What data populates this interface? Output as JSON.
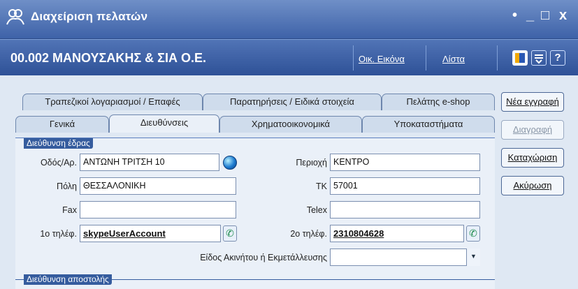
{
  "window": {
    "title": "Διαχείριση πελατών",
    "controls": [
      "•",
      "_",
      "□",
      "x"
    ]
  },
  "header": {
    "record_title": "00.002 ΜΑΝΟΥΣΑΚΗΣ & ΣΙΑ Ο.Ε.",
    "links": [
      "Οικ. Εικόνα",
      "Λίστα"
    ],
    "help": "?"
  },
  "tabs": {
    "row1": [
      "Τραπεζικοί λογαριασμοί / Επαφές",
      "Παρατηρήσεις / Ειδικά στοιχεία",
      "Πελάτης e-shop"
    ],
    "row2": [
      "Γενικά",
      "Διευθύνσεις",
      "Χρηματοοικονομικά",
      "Υποκαταστήματα"
    ],
    "active": "Διευθύνσεις"
  },
  "sections": {
    "seat": "Διεύθυνση έδρας",
    "shipping": "Διεύθυνση αποστολής"
  },
  "form": {
    "street_label": "Οδός/Αρ.",
    "street_value": "ΑΝΤΩΝΗ ΤΡΙΤΣΗ 10",
    "area_label": "Περιοχή",
    "area_value": "ΚΕΝΤΡΟ",
    "city_label": "Πόλη",
    "city_value": "ΘΕΣΣΑΛΟΝΙΚΗ",
    "zip_label": "ΤΚ",
    "zip_value": "57001",
    "fax_label": "Fax",
    "fax_value": "",
    "telex_label": "Telex",
    "telex_value": "",
    "phone1_label": "1ο τηλέφ.",
    "phone1_value": "skypeUserAccount",
    "phone2_label": "2ο τηλέφ.",
    "phone2_value": "2310804628",
    "property_label": "Είδος Ακινήτου ή Εκμετάλλευσης",
    "property_value": ""
  },
  "buttons": {
    "new": "Νέα εγγραφή",
    "delete": "Διαγραφή",
    "save": "Καταχώριση",
    "cancel": "Ακύρωση"
  }
}
